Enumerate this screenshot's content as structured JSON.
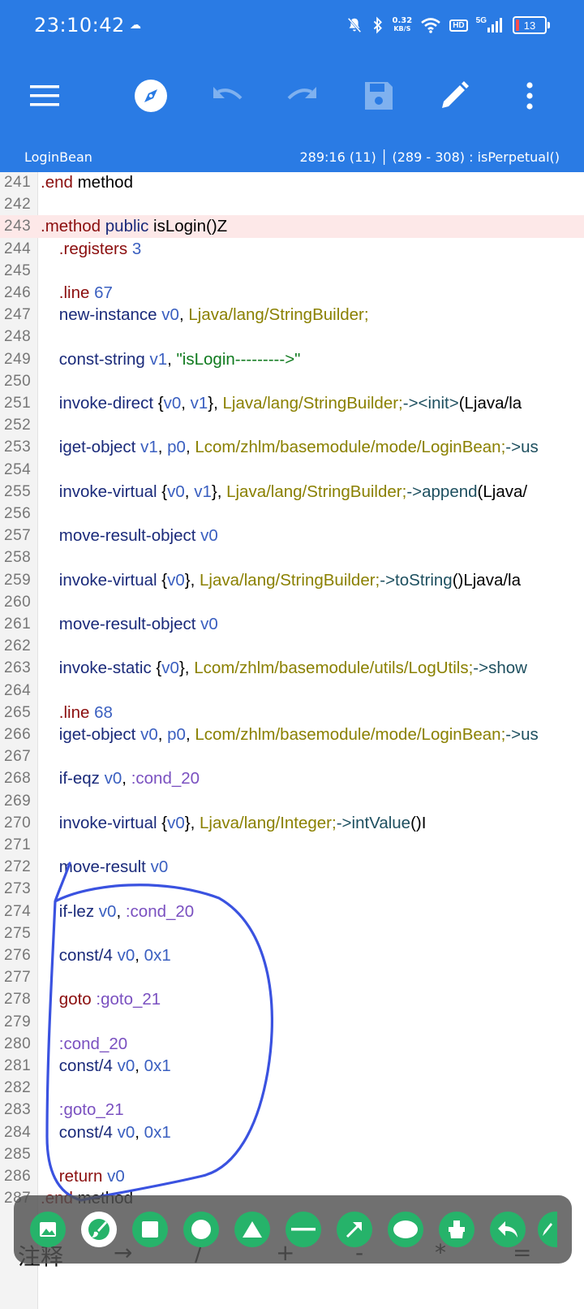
{
  "status_bar": {
    "time": "23:10:42",
    "net_speed_value": "0.32",
    "net_speed_unit": "KB/S",
    "hd_label": "HD",
    "network_label": "5G",
    "battery": "13",
    "battery_level_percent": 13
  },
  "toolbar": {
    "icons": [
      "menu-icon",
      "compass-icon",
      "undo-icon",
      "redo-icon",
      "save-icon",
      "edit-icon",
      "more-icon"
    ]
  },
  "info_bar": {
    "file_name": "LoginBean",
    "cursor_info": "289:16 (11) │ (289 - 308) : isPerpetual()"
  },
  "editor": {
    "lines": [
      {
        "n": "241",
        "t": ".end method"
      },
      {
        "n": "242",
        "t": ""
      },
      {
        "n": "243",
        "t": ".method public isLogin()Z"
      },
      {
        "n": "244",
        "t": "    .registers 3"
      },
      {
        "n": "245",
        "t": ""
      },
      {
        "n": "246",
        "t": "    .line 67"
      },
      {
        "n": "247",
        "t": "    new-instance v0, Ljava/lang/StringBuilder;"
      },
      {
        "n": "248",
        "t": ""
      },
      {
        "n": "249",
        "t": "    const-string v1, \"isLogin--------->\""
      },
      {
        "n": "250",
        "t": ""
      },
      {
        "n": "251",
        "t": "    invoke-direct {v0, v1}, Ljava/lang/StringBuilder;-><init>(Ljava/la"
      },
      {
        "n": "252",
        "t": ""
      },
      {
        "n": "253",
        "t": "    iget-object v1, p0, Lcom/zhlm/basemodule/mode/LoginBean;->us"
      },
      {
        "n": "254",
        "t": ""
      },
      {
        "n": "255",
        "t": "    invoke-virtual {v0, v1}, Ljava/lang/StringBuilder;->append(Ljava/"
      },
      {
        "n": "256",
        "t": ""
      },
      {
        "n": "257",
        "t": "    move-result-object v0"
      },
      {
        "n": "258",
        "t": ""
      },
      {
        "n": "259",
        "t": "    invoke-virtual {v0}, Ljava/lang/StringBuilder;->toString()Ljava/la"
      },
      {
        "n": "260",
        "t": ""
      },
      {
        "n": "261",
        "t": "    move-result-object v0"
      },
      {
        "n": "262",
        "t": ""
      },
      {
        "n": "263",
        "t": "    invoke-static {v0}, Lcom/zhlm/basemodule/utils/LogUtils;->show"
      },
      {
        "n": "264",
        "t": ""
      },
      {
        "n": "265",
        "t": "    .line 68"
      },
      {
        "n": "266",
        "t": "    iget-object v0, p0, Lcom/zhlm/basemodule/mode/LoginBean;->us"
      },
      {
        "n": "267",
        "t": ""
      },
      {
        "n": "268",
        "t": "    if-eqz v0, :cond_20"
      },
      {
        "n": "269",
        "t": ""
      },
      {
        "n": "270",
        "t": "    invoke-virtual {v0}, Ljava/lang/Integer;->intValue()I"
      },
      {
        "n": "271",
        "t": ""
      },
      {
        "n": "272",
        "t": "    move-result v0"
      },
      {
        "n": "273",
        "t": ""
      },
      {
        "n": "274",
        "t": "    if-lez v0, :cond_20"
      },
      {
        "n": "275",
        "t": ""
      },
      {
        "n": "276",
        "t": "    const/4 v0, 0x1"
      },
      {
        "n": "277",
        "t": ""
      },
      {
        "n": "278",
        "t": "    goto :goto_21"
      },
      {
        "n": "279",
        "t": ""
      },
      {
        "n": "280",
        "t": "    :cond_20"
      },
      {
        "n": "281",
        "t": "    const/4 v0, 0x1"
      },
      {
        "n": "282",
        "t": ""
      },
      {
        "n": "283",
        "t": "    :goto_21"
      },
      {
        "n": "284",
        "t": "    const/4 v0, 0x1"
      },
      {
        "n": "285",
        "t": ""
      },
      {
        "n": "286",
        "t": "    return v0"
      },
      {
        "n": "287",
        "t": ".end method"
      }
    ],
    "highlighted_line": "243"
  },
  "keyboard_row": {
    "keys": [
      "注释",
      "→",
      "/",
      "+",
      "-",
      "*",
      "="
    ]
  },
  "draw_toolbar": {
    "tools": [
      "image-icon",
      "brush-icon",
      "square-icon",
      "circle-icon",
      "triangle-icon",
      "line-icon",
      "arrow-icon",
      "ellipse-icon",
      "eraser-icon",
      "undo-icon",
      "pen-icon"
    ],
    "active_tool": "brush-icon"
  },
  "colors": {
    "app_bar": "#2a7be4",
    "highlight_line": "#fde8e8",
    "annotation_stroke": "#3a52e0",
    "tool_green": "#26b36a"
  }
}
